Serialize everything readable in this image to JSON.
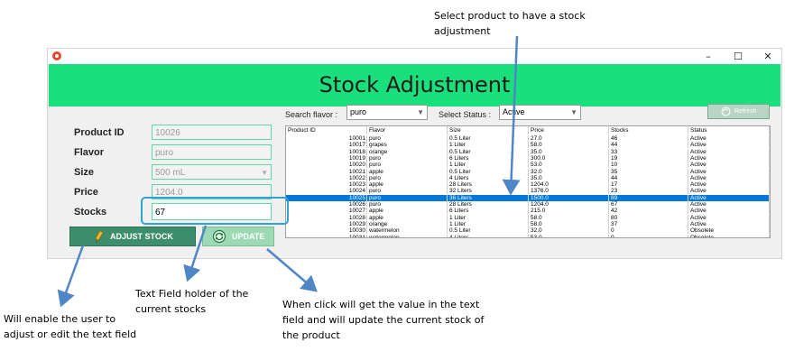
{
  "annotations": {
    "select_product": "Select product to have a stock adjustment",
    "text_field_holder": "Text Field holder of the current stocks",
    "update_note": "When click will get the value in the text field and will update the current stock of the product",
    "adjust_note": "Will enable the user to adjust or edit the text field"
  },
  "window": {
    "controls": {
      "minimize": "–",
      "maximize": "☐",
      "close": "✕"
    },
    "header_title": "Stock Adjustment",
    "header_color": "#19e07c"
  },
  "form": {
    "product_id_label": "Product ID",
    "product_id_value": "10026",
    "flavor_label": "Flavor",
    "flavor_value": "puro",
    "size_label": "Size",
    "size_value": "500 mL",
    "price_label": "Price",
    "price_value": "1204.0",
    "stocks_label": "Stocks",
    "stocks_value": "67"
  },
  "buttons": {
    "adjust_stock": "ADJUST STOCK",
    "update": "UPDATE",
    "refresh": "Refresh"
  },
  "filters": {
    "search_flavor_label": "Search flavor :",
    "search_flavor_value": "puro",
    "select_status_label": "Select Status :",
    "select_status_value": "Active"
  },
  "table": {
    "columns": [
      "Product ID",
      "Flavor",
      "Size",
      "Price",
      "Stocks",
      "Status"
    ],
    "selected_index": 9,
    "rows": [
      [
        "10001",
        "puro",
        "0.5 Liter",
        "27.0",
        "46",
        "Active"
      ],
      [
        "10017",
        "grapes",
        "1 Liter",
        "58.0",
        "44",
        "Active"
      ],
      [
        "10018",
        "orange",
        "0.5 Liter",
        "35.0",
        "33",
        "Active"
      ],
      [
        "10019",
        "puro",
        "6 Liters",
        "300.0",
        "19",
        "Active"
      ],
      [
        "10020",
        "puro",
        "1 Liter",
        "53.0",
        "10",
        "Active"
      ],
      [
        "10021",
        "apple",
        "0.5 Liter",
        "32.0",
        "35",
        "Active"
      ],
      [
        "10022",
        "puro",
        "4 Liters",
        "35.0",
        "44",
        "Active"
      ],
      [
        "10023",
        "apple",
        "28 Liters",
        "1204.0",
        "17",
        "Active"
      ],
      [
        "10024",
        "puro",
        "32 Liters",
        "1376.0",
        "23",
        "Active"
      ],
      [
        "10025",
        "puro",
        "36 Liters",
        "1500.0",
        "89",
        "Active"
      ],
      [
        "10026",
        "puro",
        "28 Liters",
        "1204.0",
        "67",
        "Active"
      ],
      [
        "10027",
        "apple",
        "6 Liters",
        "215.0",
        "42",
        "Active"
      ],
      [
        "10028",
        "apple",
        "1 Liter",
        "58.0",
        "80",
        "Active"
      ],
      [
        "10029",
        "orange",
        "1 Liter",
        "58.0",
        "37",
        "Active"
      ],
      [
        "10030",
        "watermelon",
        "0.5 Liter",
        "32.0",
        "0",
        "Obsolete"
      ],
      [
        "10031",
        "watermelon",
        "4 Liters",
        "53.0",
        "0",
        "Obsolete"
      ]
    ]
  }
}
